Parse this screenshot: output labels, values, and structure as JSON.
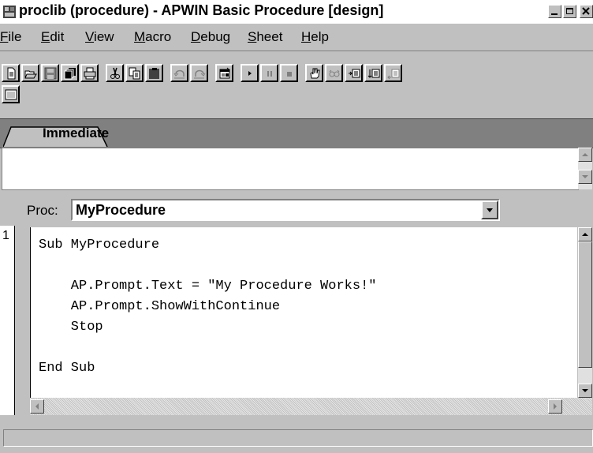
{
  "window": {
    "title": "proclib (procedure) - APWIN Basic Procedure [design]",
    "minimize_icon": "minimize-icon",
    "maximize_icon": "maximize-icon",
    "close_icon": "close-icon"
  },
  "menubar": {
    "items": [
      {
        "label": "File",
        "accel": "F",
        "rest": "ile"
      },
      {
        "label": "Edit",
        "accel": "E",
        "rest": "dit"
      },
      {
        "label": "View",
        "accel": "V",
        "rest": "iew"
      },
      {
        "label": "Macro",
        "accel": "M",
        "rest": "acro"
      },
      {
        "label": "Debug",
        "accel": "D",
        "rest": "ebug"
      },
      {
        "label": "Sheet",
        "accel": "S",
        "rest": "heet"
      },
      {
        "label": "Help",
        "accel": "H",
        "rest": "elp"
      }
    ]
  },
  "toolbar": {
    "icons": [
      "new-icon",
      "open-icon",
      "save-icon",
      "copy-sheets-icon",
      "print-icon",
      "cut-icon",
      "copy-icon",
      "paste-icon",
      "undo-icon",
      "redo-icon",
      "dialog-editor-icon",
      "run-icon",
      "pause-icon",
      "stop-icon",
      "toggle-breakpoint-icon",
      "quick-watch-icon",
      "step-into-icon",
      "step-over-icon",
      "step-out-icon",
      "immediate-window-icon"
    ]
  },
  "tabs": {
    "immediate": "Immediate"
  },
  "proc": {
    "label": "Proc:",
    "value": "MyProcedure"
  },
  "editor": {
    "line_number": "1",
    "code": "Sub MyProcedure\n\n    AP.Prompt.Text = \"My Procedure Works!\"\n    AP.Prompt.ShowWithContinue\n    Stop\n\nEnd Sub"
  },
  "colors": {
    "face": "#c0c0c0",
    "shadow": "#808080",
    "highlight": "#ffffff",
    "text": "#000000"
  }
}
